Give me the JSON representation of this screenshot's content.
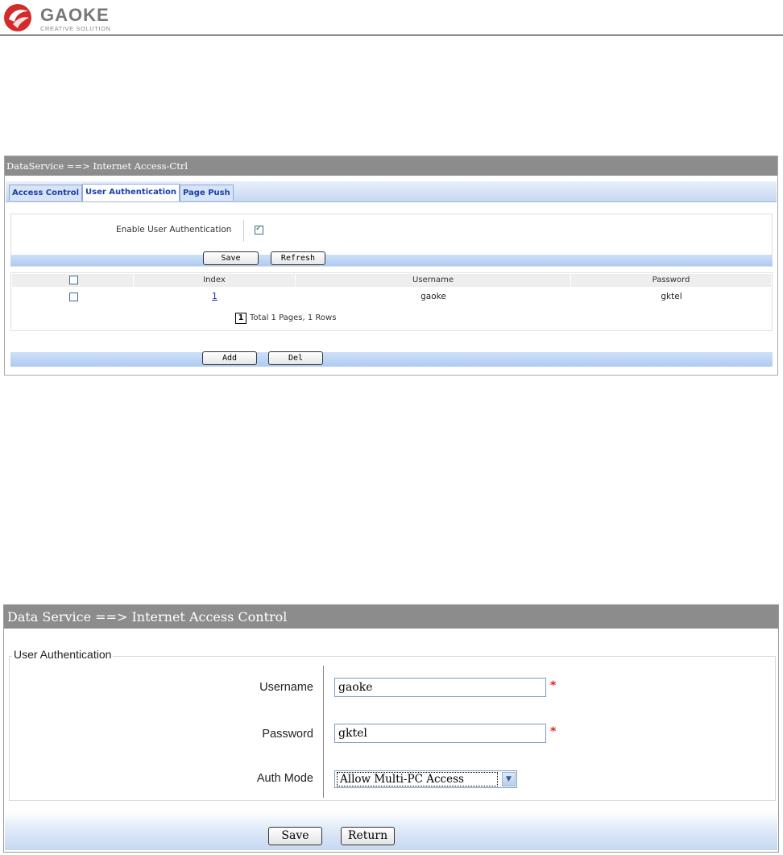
{
  "header": {
    "logo_text": "GAOKE",
    "logo_subtitle": "CREATIVE SOLUTION"
  },
  "panel1": {
    "title": "DataService ==> Internet Access-Ctrl",
    "tabs": [
      {
        "label": "Access Control",
        "active": false
      },
      {
        "label": "User Authentication",
        "active": true
      },
      {
        "label": "Page Push",
        "active": false
      }
    ],
    "enable_label": "Enable User Authentication",
    "enable_checked": true,
    "save_label": "Save",
    "refresh_label": "Refresh",
    "table": {
      "headers": [
        "Index",
        "Username",
        "Password"
      ],
      "rows": [
        {
          "index": "1",
          "username": "gaoke",
          "password": "gktel"
        }
      ]
    },
    "pagination": {
      "current_page": "1",
      "summary": "Total 1 Pages, 1 Rows"
    },
    "add_label": "Add",
    "del_label": "Del"
  },
  "panel2": {
    "title": "Data Service ==> Internet Access Control",
    "section_legend": "User Authentication",
    "username_label": "Username",
    "username_value": "gaoke",
    "password_label": "Password",
    "password_value": "gktel",
    "auth_mode_label": "Auth Mode",
    "auth_mode_value": "Allow Multi-PC Access",
    "required_mark": "*",
    "save_label": "Save",
    "return_label": "Return"
  },
  "colors": {
    "title_bar": "#8c8c8c",
    "tab_text": "#1a3fa8",
    "link": "#1a1ad0",
    "required": "#e02020",
    "strip_blue": "#c6d8f1"
  }
}
